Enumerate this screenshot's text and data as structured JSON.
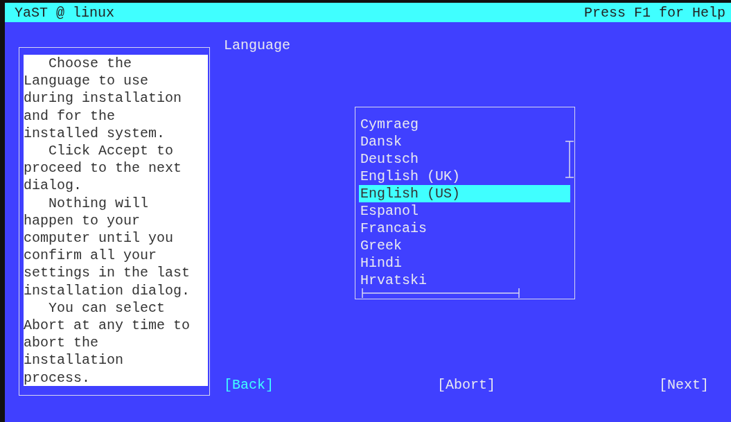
{
  "title_bar": {
    "title": "YaST @ linux",
    "help_hint": "Press F1 for Help"
  },
  "help_text": [
    "Choose the Language to use during installation and for the installed system.",
    "Click Accept to proceed to the next dialog.",
    "Nothing will happen to your computer until you confirm all your settings in the last installation dialog.",
    "You can select Abort at any time to abort the installation process."
  ],
  "language_list": {
    "label": "Language",
    "items": [
      {
        "name": "Cymraeg",
        "selected": false
      },
      {
        "name": "Dansk",
        "selected": false
      },
      {
        "name": "Deutsch",
        "selected": false
      },
      {
        "name": "English (UK)",
        "selected": false
      },
      {
        "name": "English (US)",
        "selected": true
      },
      {
        "name": "Espanol",
        "selected": false
      },
      {
        "name": "Francais",
        "selected": false
      },
      {
        "name": "Greek",
        "selected": false
      },
      {
        "name": "Hindi",
        "selected": false
      },
      {
        "name": "Hrvatski",
        "selected": false
      }
    ]
  },
  "buttons": [
    {
      "label": "[Back]",
      "focused": true
    },
    {
      "label": "[Abort]",
      "focused": false
    },
    {
      "label": "[Next]",
      "focused": false
    }
  ]
}
